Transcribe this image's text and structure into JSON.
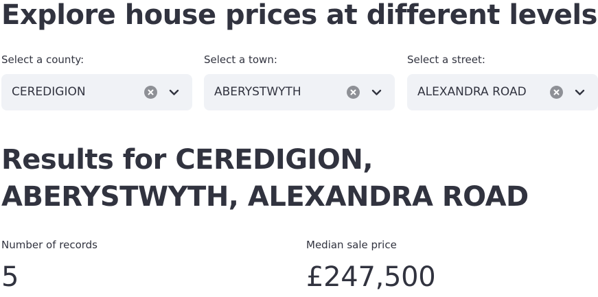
{
  "header": {
    "title": "Explore house prices at different levels"
  },
  "filters": {
    "county": {
      "label": "Select a county:",
      "value": "CEREDIGION"
    },
    "town": {
      "label": "Select a town:",
      "value": "ABERYSTWYTH"
    },
    "street": {
      "label": "Select a street:",
      "value": "ALEXANDRA ROAD"
    },
    "icons": {
      "clear": "clear-icon",
      "dropdown": "chevron-down-icon"
    }
  },
  "results": {
    "title": "Results for CEREDIGION, ABERYSTWYTH, ALEXANDRA ROAD",
    "metrics": [
      {
        "label": "Number of records",
        "value": "5"
      },
      {
        "label": "Median sale price",
        "value": "£247,500"
      }
    ]
  },
  "colors": {
    "text": "#31333f",
    "select_background": "#f0f2f6",
    "clear_icon": "#8e9096"
  }
}
